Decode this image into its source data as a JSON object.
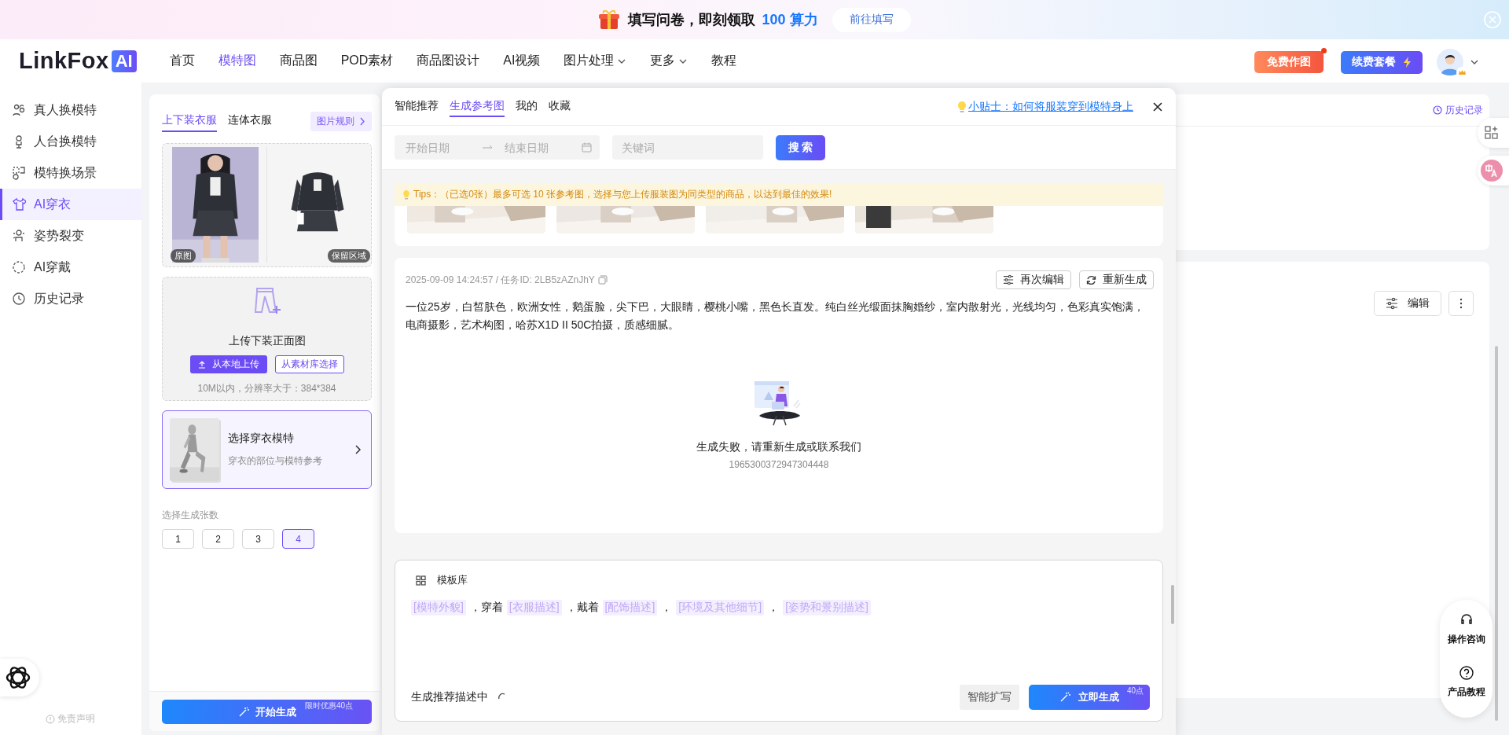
{
  "banner": {
    "text": "填写问卷，即刻领取",
    "highlight": "100 算力",
    "button": "前往填写"
  },
  "nav": {
    "logo": "LinkFox",
    "logo_badge": "AI",
    "items": [
      {
        "label": "首页",
        "selected": false,
        "has_dropdown": false
      },
      {
        "label": "模特图",
        "selected": true,
        "has_dropdown": false
      },
      {
        "label": "商品图",
        "selected": false,
        "has_dropdown": false
      },
      {
        "label": "POD素材",
        "selected": false,
        "has_dropdown": false
      },
      {
        "label": "商品图设计",
        "selected": false,
        "has_dropdown": false
      },
      {
        "label": "AI视频",
        "selected": false,
        "has_dropdown": false
      },
      {
        "label": "图片处理",
        "selected": false,
        "has_dropdown": true
      },
      {
        "label": "更多",
        "selected": false,
        "has_dropdown": true
      },
      {
        "label": "教程",
        "selected": false,
        "has_dropdown": false
      }
    ],
    "free_button": {
      "label": "免费作图",
      "has_notification": true
    },
    "renew_button": "续费套餐"
  },
  "sidebar": {
    "items": [
      {
        "label": "真人换模特",
        "selected": false
      },
      {
        "label": "人台换模特",
        "selected": false
      },
      {
        "label": "模特换场景",
        "selected": false
      },
      {
        "label": "AI穿衣",
        "selected": true
      },
      {
        "label": "姿势裂变",
        "selected": false
      },
      {
        "label": "AI穿戴",
        "selected": false
      },
      {
        "label": "历史记录",
        "selected": false
      }
    ],
    "footer": "免责声明"
  },
  "left_panel": {
    "tabs": [
      {
        "label": "上下装衣服",
        "selected": true
      },
      {
        "label": "连体衣服",
        "selected": false
      }
    ],
    "rules_link": "图片规则",
    "images": [
      {
        "label": "原图"
      },
      {
        "label": "保留区域"
      }
    ],
    "upload": {
      "title": "上传下装正面图",
      "local_button": "从本地上传",
      "library_button": "从素材库选择",
      "hint": "10M以内，分辨率大于：384*384"
    },
    "model": {
      "title": "选择穿衣模特",
      "subtitle": "穿衣的部位与模特参考"
    },
    "count": {
      "label": "选择生成张数",
      "options": [
        {
          "label": "1",
          "selected": false
        },
        {
          "label": "2",
          "selected": false
        },
        {
          "label": "3",
          "selected": false
        },
        {
          "label": "4",
          "selected": true
        }
      ]
    },
    "start": {
      "label": "开始生成",
      "badge": "限时优惠40点"
    }
  },
  "modal": {
    "tabs": [
      {
        "label": "智能推荐",
        "selected": false
      },
      {
        "label": "生成参考图",
        "selected": true
      },
      {
        "label": "我的",
        "selected": false
      },
      {
        "label": "收藏",
        "selected": false
      }
    ],
    "tip_link": "小贴士：如何将服装穿到模特身上",
    "filters": {
      "start_placeholder": "开始日期",
      "end_placeholder": "结束日期",
      "keyword_placeholder": "关键词",
      "search_button": "搜 索"
    },
    "tips": "Tips：（已选0张）最多可选 10 张参考图，选择与您上传服装图为同类型的商品，以达到最佳的效果!",
    "task": {
      "meta": "2025-09-09 14:24:57 / 任务ID: 2LB5zAZnJhY",
      "edit_button": "再次编辑",
      "regenerate_button": "重新生成",
      "prompt": "一位25岁，白皙肤色，欧洲女性，鹅蛋脸，尖下巴，大眼睛，樱桃小嘴，黑色长直发。纯白丝光缎面抹胸婚纱，室内散射光，光线均匀，色彩真实饱满，电商摄影，艺术构图，哈苏X1D II 50C拍摄，质感细腻。",
      "error": "生成失败，请重新生成或联系我们",
      "error_id": "1965300372947304448"
    },
    "composer": {
      "title": "模板库",
      "segments": [
        {
          "kind": "tag",
          "text": "[模特外貌]"
        },
        {
          "kind": "text",
          "text": "，穿着"
        },
        {
          "kind": "tag",
          "text": "[衣服描述]"
        },
        {
          "kind": "text",
          "text": "，戴着"
        },
        {
          "kind": "tag",
          "text": "[配饰描述]"
        },
        {
          "kind": "text",
          "text": "，"
        },
        {
          "kind": "tag",
          "text": "[环境及其他细节]"
        },
        {
          "kind": "text",
          "text": "，"
        },
        {
          "kind": "tag",
          "text": "[姿势和景别描述]"
        }
      ],
      "status": "生成推荐描述中",
      "expand_button": "智能扩写",
      "generate_button": "立即生成",
      "generate_badge": "40点"
    }
  },
  "workspace": {
    "history_link": "历史记录",
    "edit_button": "编辑"
  },
  "help": [
    {
      "label": "操作咨询"
    },
    {
      "label": "产品教程"
    }
  ]
}
